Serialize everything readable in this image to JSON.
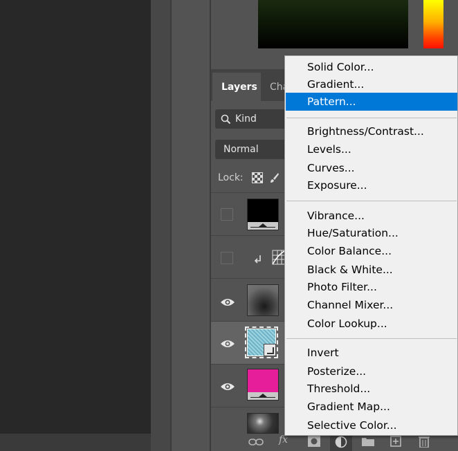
{
  "colors": {
    "menu_background": "#f0f0f0",
    "menu_highlight": "#0078d7",
    "panel_background": "#535353",
    "canvas_background": "#282828",
    "fill_swatch": "#e61e99"
  },
  "layers_panel": {
    "tabs": [
      {
        "label": "Layers",
        "active": true
      },
      {
        "label": "Cha",
        "active": false
      }
    ],
    "filter": {
      "label": "Kind",
      "icon": "search-icon"
    },
    "blend_mode": "Normal",
    "lock_label": "Lock:",
    "rows": [
      {
        "kind": "solid-fill-black",
        "visible": false
      },
      {
        "kind": "curves-adjustment-clipped",
        "visible": false
      },
      {
        "kind": "image",
        "visible": true
      },
      {
        "kind": "smart-object-pattern",
        "visible": true,
        "selected": true
      },
      {
        "kind": "solid-fill-pink",
        "visible": true
      },
      {
        "kind": "image-partial",
        "visible": false
      }
    ],
    "footer_icons": [
      "link-icon",
      "fx-icon",
      "mask-icon",
      "adjustment-icon",
      "group-icon",
      "new-layer-icon",
      "trash-icon"
    ],
    "fx_label": "fx"
  },
  "menu": {
    "groups": [
      {
        "items": [
          "Solid Color...",
          "Gradient...",
          "Pattern..."
        ]
      },
      {
        "items": [
          "Brightness/Contrast...",
          "Levels...",
          "Curves...",
          "Exposure..."
        ]
      },
      {
        "items": [
          "Vibrance...",
          "Hue/Saturation...",
          "Color Balance...",
          "Black & White...",
          "Photo Filter...",
          "Channel Mixer...",
          "Color Lookup..."
        ]
      },
      {
        "items": [
          "Invert",
          "Posterize...",
          "Threshold...",
          "Gradient Map...",
          "Selective Color..."
        ]
      }
    ],
    "highlighted": "Pattern..."
  }
}
